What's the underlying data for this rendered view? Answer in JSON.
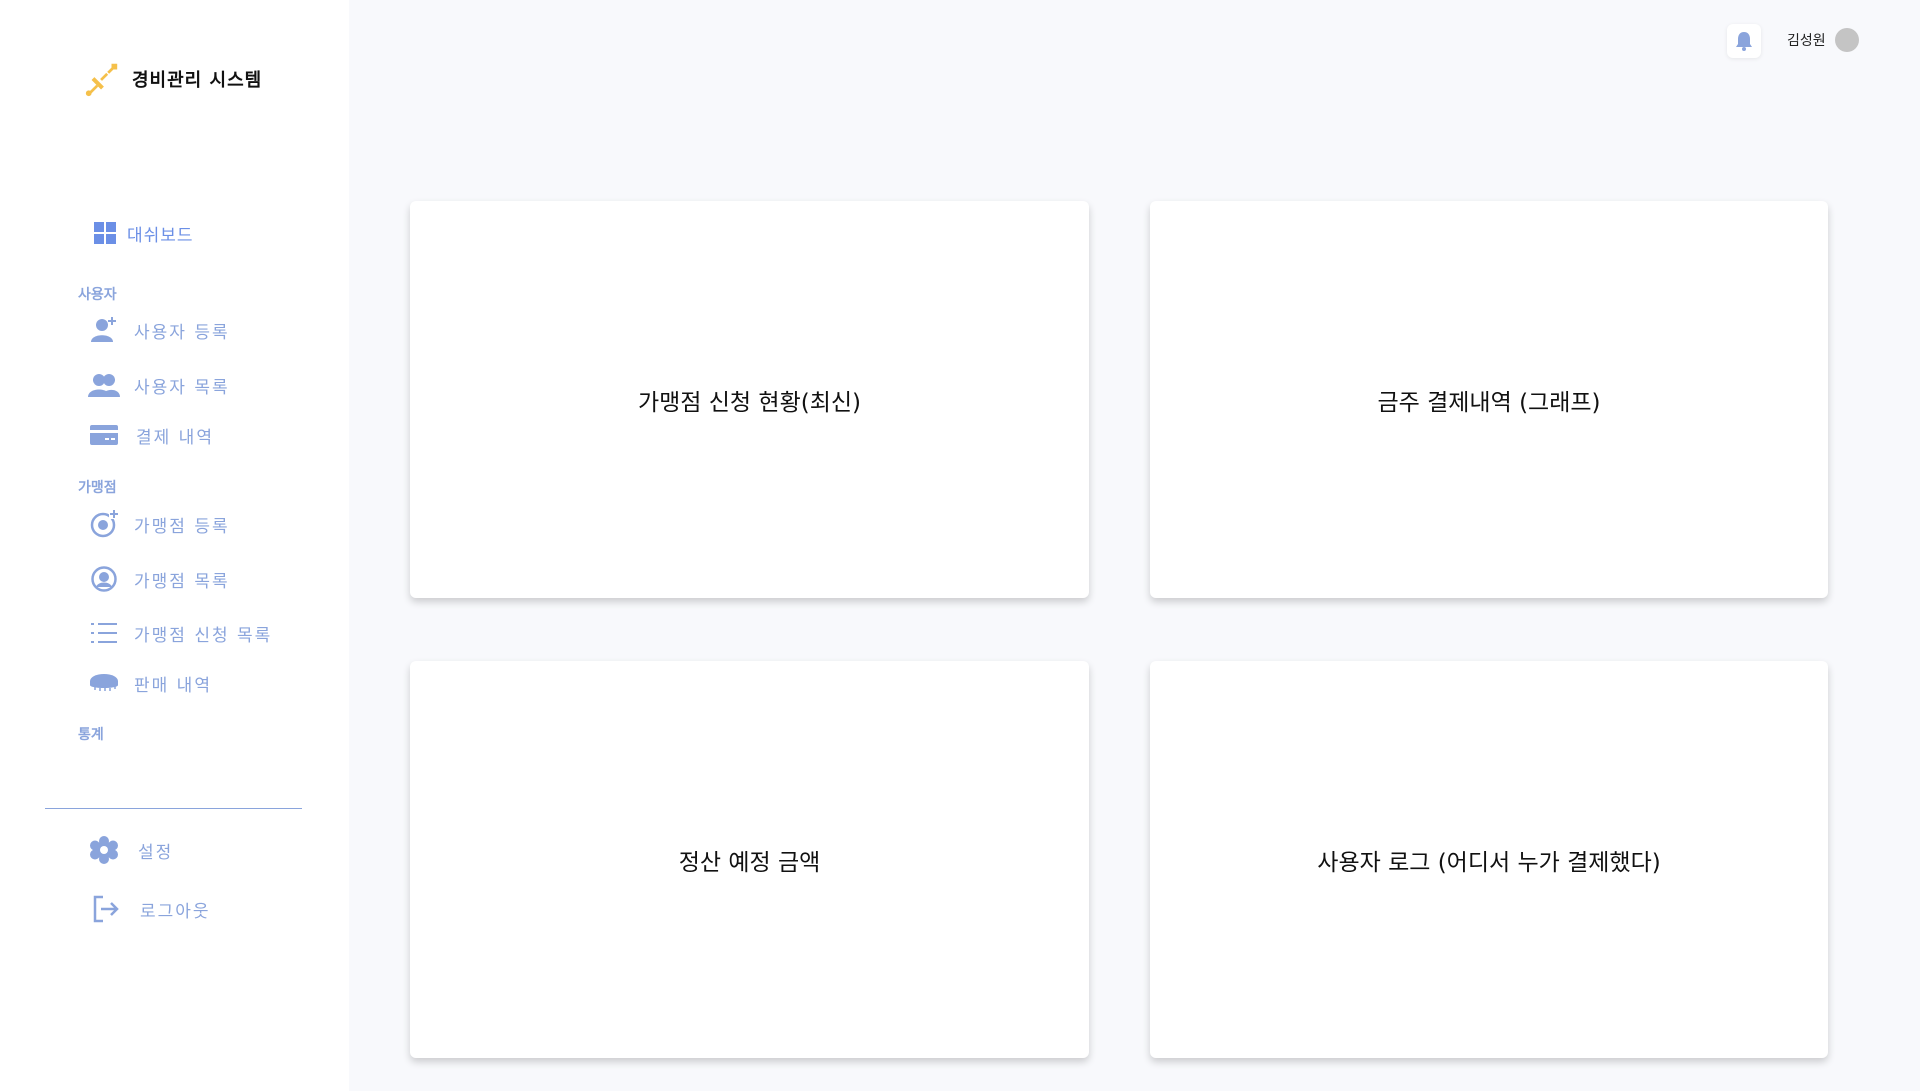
{
  "app": {
    "title": "경비관리 시스템"
  },
  "sidebar": {
    "dashboard": {
      "label": "대쉬보드"
    },
    "sections": {
      "user": "사용자",
      "franchise": "가맹점",
      "stats": "통계"
    },
    "user_items": [
      {
        "label": "사용자 등록",
        "icon": "add-user-icon"
      },
      {
        "label": "사용자 목록",
        "icon": "users-icon"
      },
      {
        "label": "결제 내역",
        "icon": "credit-card-icon"
      }
    ],
    "franchise_items": [
      {
        "label": "가맹점 등록",
        "icon": "add-store-icon"
      },
      {
        "label": "가맹점 목록",
        "icon": "store-circle-icon"
      },
      {
        "label": "가맹점 신청 목록",
        "icon": "list-icon"
      },
      {
        "label": "판매 내역",
        "icon": "coin-icon"
      }
    ],
    "bottom_items": [
      {
        "label": "설정",
        "icon": "gear-icon"
      },
      {
        "label": "로그아웃",
        "icon": "logout-icon"
      }
    ]
  },
  "topbar": {
    "user_name": "김성원"
  },
  "cards": [
    {
      "title": "가맹점 신청 현황(최신)"
    },
    {
      "title": "금주 결제내역 (그래프)"
    },
    {
      "title": "정산 예정 금액"
    },
    {
      "title": "사용자 로그 (어디서 누가 결제했다)"
    }
  ],
  "colors": {
    "accent": "#6b8fe6",
    "nav_text": "#8aa4dc",
    "logo": "#f5c04a",
    "background": "#f8f9fc"
  }
}
